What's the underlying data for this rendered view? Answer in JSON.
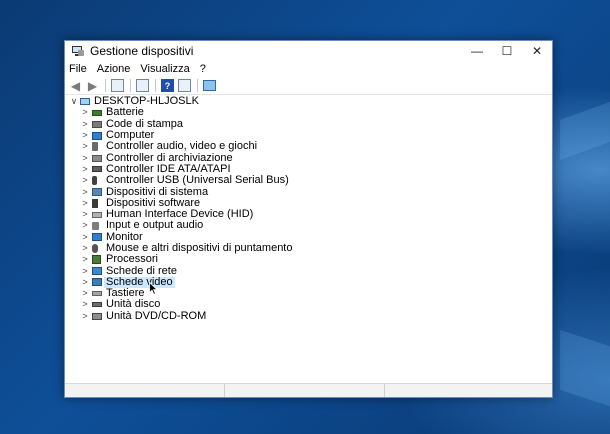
{
  "window": {
    "title": "Gestione dispositivi",
    "controls": {
      "minimize": "—",
      "maximize": "☐",
      "close": "✕"
    }
  },
  "menu": {
    "items": [
      "File",
      "Azione",
      "Visualizza",
      "?"
    ]
  },
  "toolbar": {
    "buttons": [
      {
        "icon": "back-arrow-icon"
      },
      {
        "icon": "forward-arrow-icon"
      },
      {
        "icon": "show-hide-console-tree-icon"
      },
      {
        "icon": "properties-icon"
      },
      {
        "icon": "help-icon",
        "label": "?"
      },
      {
        "icon": "update-driver-icon"
      },
      {
        "icon": "scan-hardware-changes-icon"
      }
    ]
  },
  "tree": {
    "root": {
      "label": "DESKTOP-HLJOSLK",
      "expanded": true,
      "icon": "computer-icon"
    },
    "children": [
      {
        "label": "Batterie",
        "icon": "battery-icon"
      },
      {
        "label": "Code di stampa",
        "icon": "printer-icon"
      },
      {
        "label": "Computer",
        "icon": "monitor-icon"
      },
      {
        "label": "Controller audio, video e giochi",
        "icon": "speaker-icon"
      },
      {
        "label": "Controller di archiviazione",
        "icon": "storage-controller-icon"
      },
      {
        "label": "Controller IDE ATA/ATAPI",
        "icon": "ide-controller-icon"
      },
      {
        "label": "Controller USB (Universal Serial Bus)",
        "icon": "usb-icon"
      },
      {
        "label": "Dispositivi di sistema",
        "icon": "system-device-icon"
      },
      {
        "label": "Dispositivi software",
        "icon": "software-device-icon"
      },
      {
        "label": "Human Interface Device (HID)",
        "icon": "hid-icon"
      },
      {
        "label": "Input e output audio",
        "icon": "audio-io-icon"
      },
      {
        "label": "Monitor",
        "icon": "monitor-icon"
      },
      {
        "label": "Mouse e altri dispositivi di puntamento",
        "icon": "mouse-icon"
      },
      {
        "label": "Processori",
        "icon": "processor-icon"
      },
      {
        "label": "Schede di rete",
        "icon": "network-adapter-icon"
      },
      {
        "label": "Schede video",
        "icon": "display-adapter-icon",
        "selected": true
      },
      {
        "label": "Tastiere",
        "icon": "keyboard-icon"
      },
      {
        "label": "Unità disco",
        "icon": "disk-drive-icon"
      },
      {
        "label": "Unità DVD/CD-ROM",
        "icon": "dvd-drive-icon"
      }
    ]
  },
  "colors": {
    "selection": "#cce8ff",
    "desktop": "#0e4f98"
  }
}
